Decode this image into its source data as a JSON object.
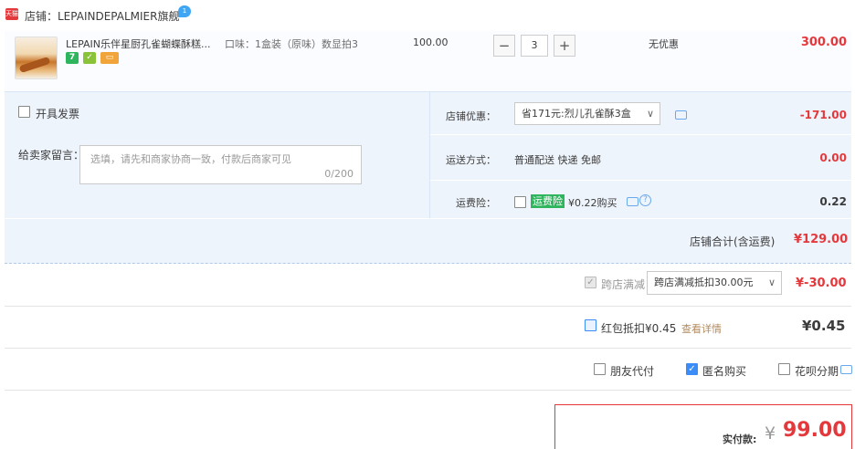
{
  "shop": {
    "badge": "天猫",
    "name": "店铺：LEPAINDEPALMIER旗舰",
    "chat_badge": "1"
  },
  "item": {
    "title": "LEPAIN乐伴星厨孔雀蝴蝶酥糕...",
    "badges": [
      "7",
      "",
      ""
    ],
    "spec": "口味：1盒装（原味）数显拍3",
    "unit_price": "100.00",
    "quantity": "3",
    "promo": "无优惠",
    "total": "300.00"
  },
  "options": {
    "invoice_label": "开具发票",
    "message_label": "给卖家留言：",
    "message_placeholder": "选填，请先和商家协商一致，付款后商家可见",
    "message_count": "0/200",
    "shop_discount_label": "店铺优惠：",
    "shop_discount_select": "省171元:烈儿孔雀酥3盒",
    "shop_discount_value": "-171.00",
    "shipping_label": "运送方式：",
    "shipping_text": "普通配送 快递 免邮",
    "shipping_value": "0.00",
    "insurance_label": "运费险：",
    "insurance_tag": "运费险",
    "insurance_text": "¥0.22购买",
    "insurance_value": "0.22"
  },
  "shop_total": {
    "label": "店铺合计(含运费)",
    "value": "¥129.00"
  },
  "cross_store": {
    "label": "跨店满减",
    "select": "跨店满减抵扣30.00元",
    "value": "¥-30.00"
  },
  "red_packet": {
    "label": "红包抵扣¥0.45",
    "detail": "查看详情",
    "value": "¥0.45"
  },
  "pay_options": {
    "friend_pay": "朋友代付",
    "anonymous": "匿名购买",
    "huabei": "花呗分期"
  },
  "final": {
    "label": "实付款:",
    "currency": "¥",
    "value": "99.00"
  }
}
